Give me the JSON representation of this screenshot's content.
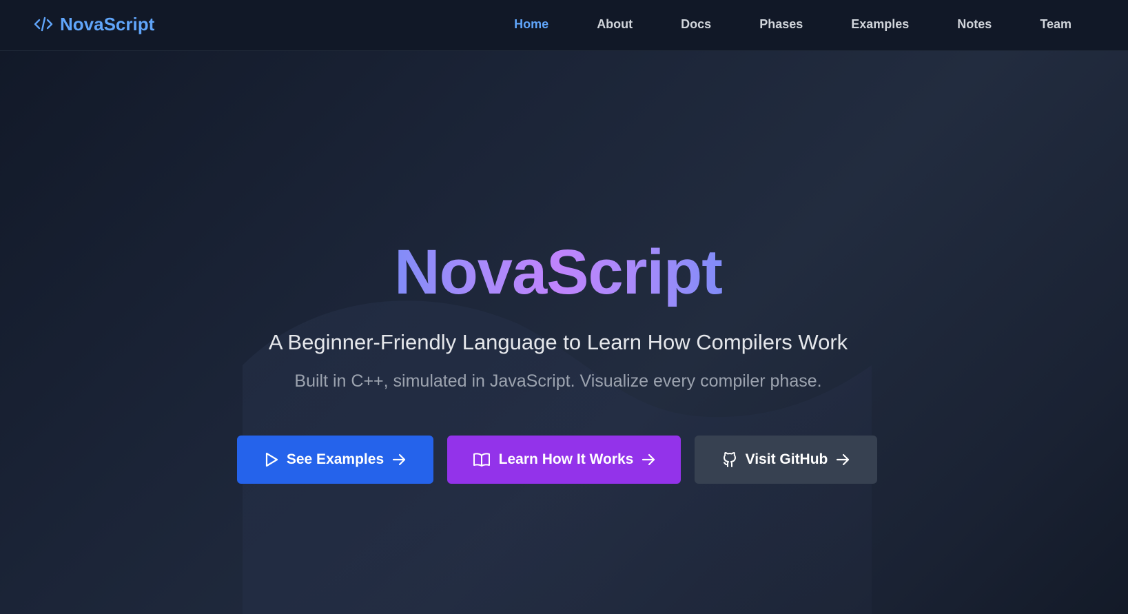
{
  "brand": {
    "name": "NovaScript",
    "icon": "code-icon",
    "color": "#60a5fa"
  },
  "nav": {
    "items": [
      {
        "label": "Home",
        "active": true
      },
      {
        "label": "About",
        "active": false
      },
      {
        "label": "Docs",
        "active": false
      },
      {
        "label": "Phases",
        "active": false
      },
      {
        "label": "Examples",
        "active": false
      },
      {
        "label": "Notes",
        "active": false
      },
      {
        "label": "Team",
        "active": false
      }
    ],
    "active_color": "#60a5fa"
  },
  "hero": {
    "title": "NovaScript",
    "subtitle": "A Beginner-Friendly Language to Learn How Compilers Work",
    "tagline": "Built in C++, simulated in JavaScript. Visualize every compiler phase."
  },
  "cta": {
    "see_examples": {
      "label": "See Examples",
      "icon": "play-icon",
      "color": "#2563eb"
    },
    "learn": {
      "label": "Learn How It Works",
      "icon": "book-open-icon",
      "color": "#9333ea"
    },
    "github": {
      "label": "Visit GitHub",
      "icon": "github-icon",
      "color": "#374151"
    }
  },
  "colors": {
    "background": "#111827",
    "title_gradient": [
      "#818cf8",
      "#c084fc"
    ]
  }
}
